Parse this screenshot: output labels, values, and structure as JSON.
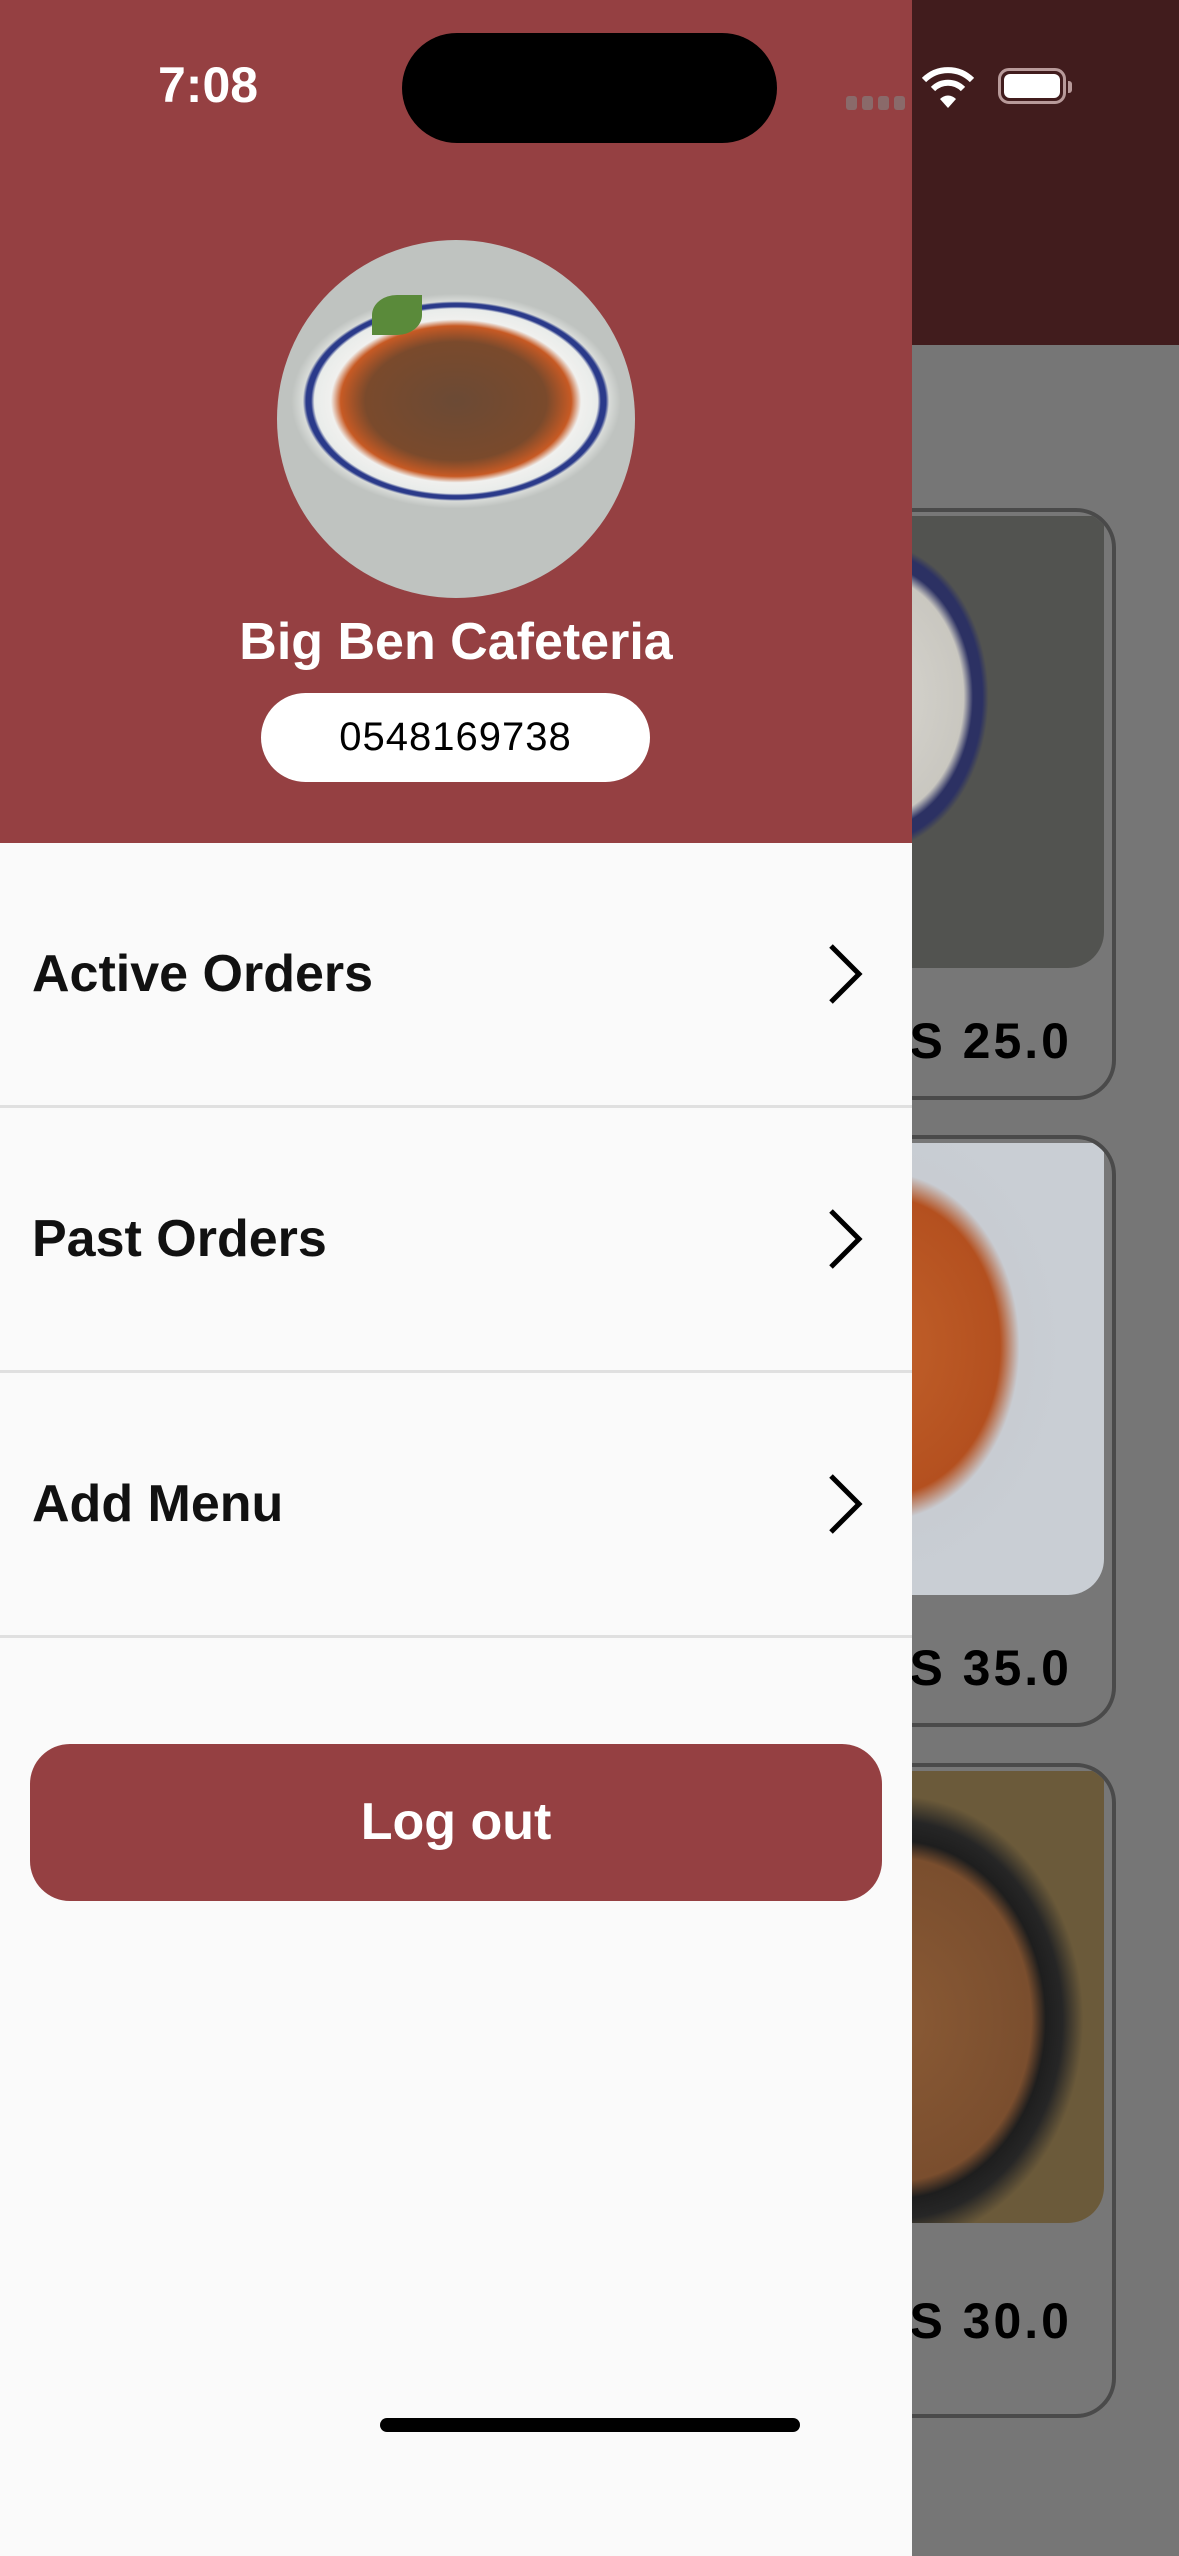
{
  "status_bar": {
    "time": "7:08"
  },
  "drawer": {
    "restaurant_name": "Big Ben Cafeteria",
    "phone": "0548169738",
    "menu_items": [
      {
        "label": "Active Orders",
        "icon": "chevron-right-icon"
      },
      {
        "label": "Past Orders",
        "icon": "chevron-right-icon"
      },
      {
        "label": "Add Menu",
        "icon": "chevron-right-icon"
      }
    ],
    "logout_label": "Log out"
  },
  "background": {
    "menu_cards": [
      {
        "price": "S 25.0"
      },
      {
        "price": "S 35.0"
      },
      {
        "price": "S 30.0"
      }
    ]
  },
  "colors": {
    "primary": "#954042",
    "appbar_dimmed": "#411c1d",
    "drawer_bg": "#fafafa"
  }
}
